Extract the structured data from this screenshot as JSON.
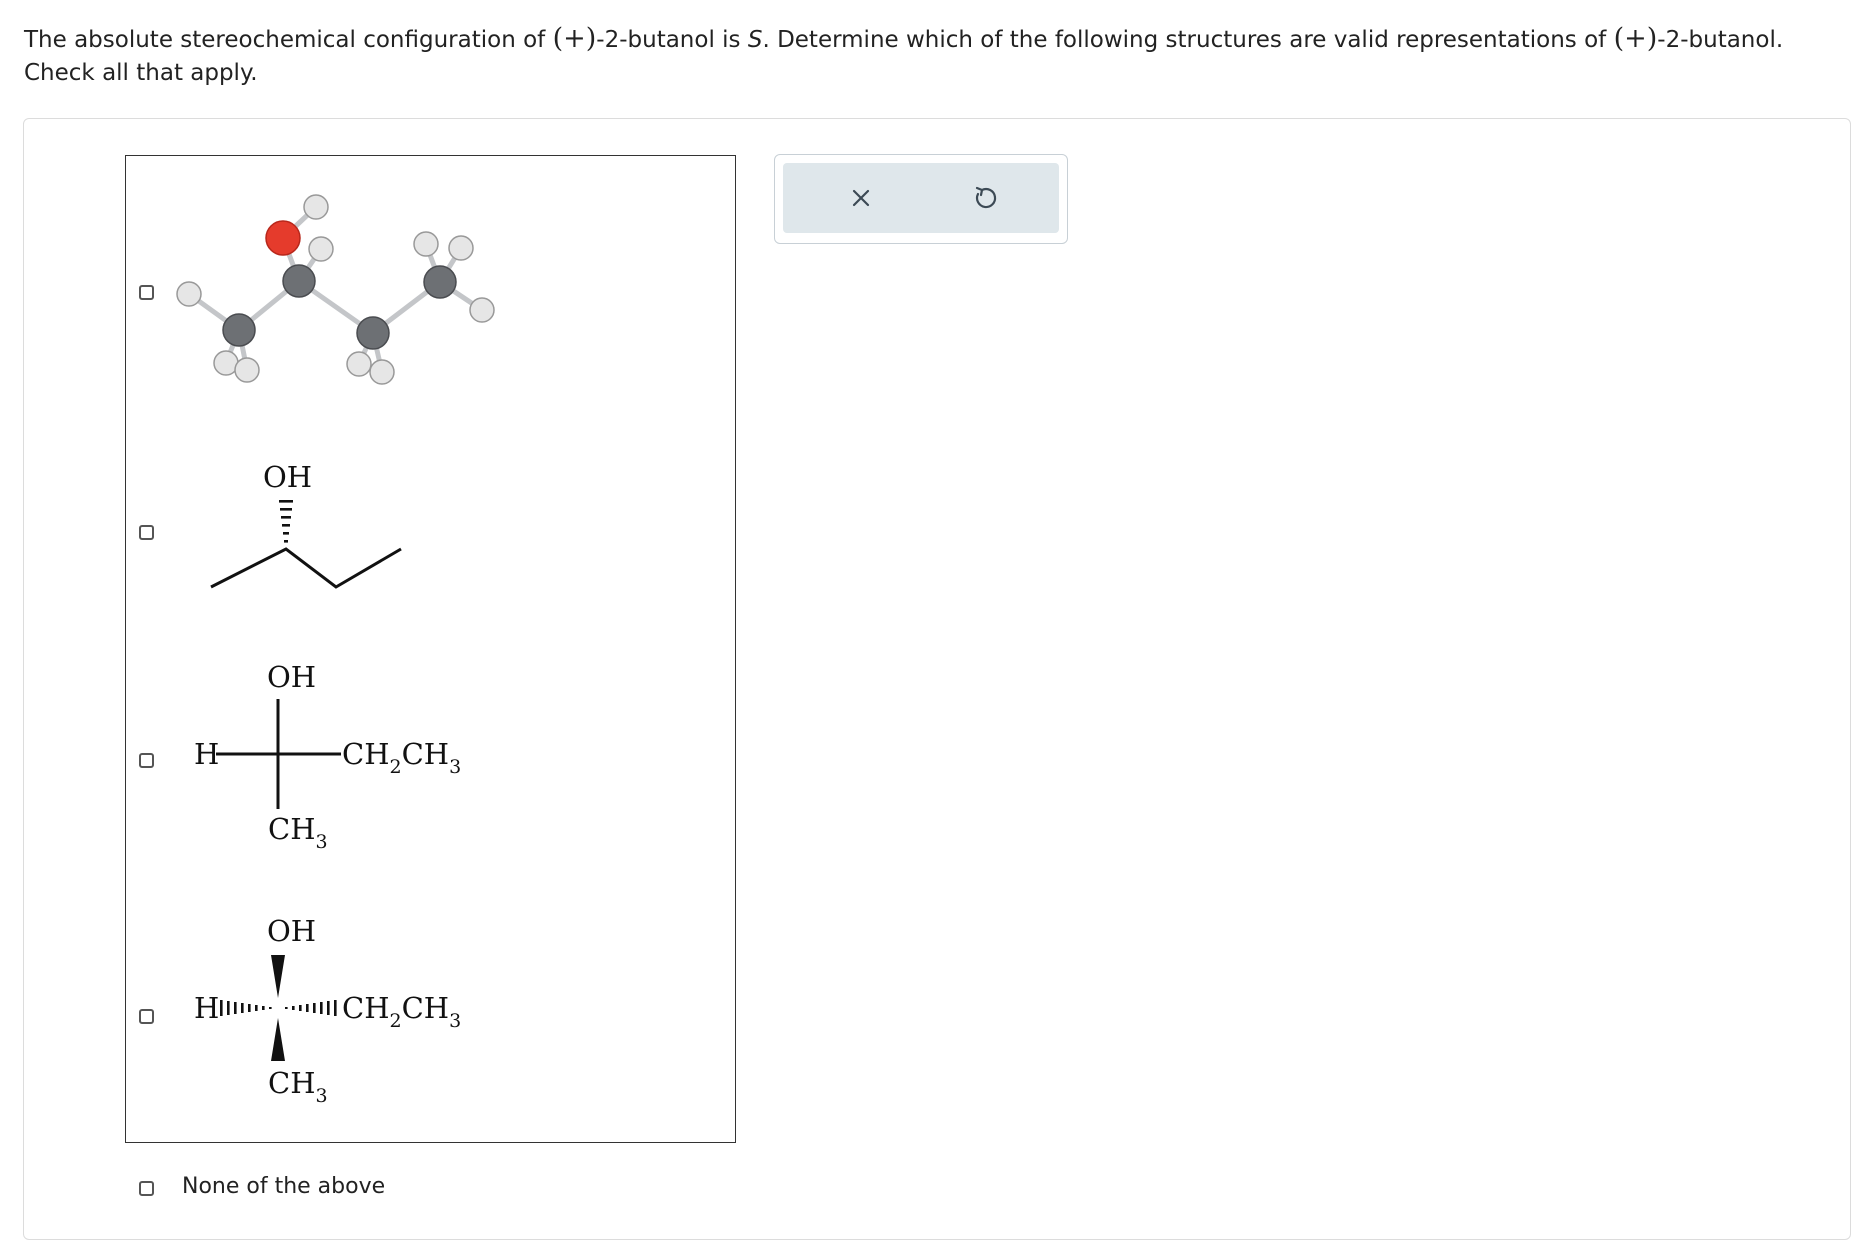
{
  "question": {
    "part1": "The absolute stereochemical configuration of ",
    "plus1": "(+)",
    "part2": "-2-butanol is ",
    "config": "S",
    "part3": ". Determine which of the following structures are valid representations of ",
    "plus2": "(+)",
    "part4": "-2-butanol. Check all that apply."
  },
  "options": [
    {
      "kind": "ball-and-stick model",
      "checked": false
    },
    {
      "kind": "skeletal formula",
      "label_oh": "OH",
      "checked": false
    },
    {
      "kind": "Fischer projection",
      "top": "OH",
      "left": "H",
      "right_main": "CH",
      "right_sub1": "2",
      "right_main2": "CH",
      "right_sub2": "3",
      "bottom_main": "CH",
      "bottom_sub": "3",
      "checked": false
    },
    {
      "kind": "wedge projection",
      "top": "OH",
      "left": "H",
      "right_main": "CH",
      "right_sub1": "2",
      "right_main2": "CH",
      "right_sub2": "3",
      "bottom_main": "CH",
      "bottom_sub": "3",
      "checked": false
    }
  ],
  "none_option": {
    "label": "None of the above",
    "checked": false
  },
  "toolbar": {
    "clear_icon": "close-icon",
    "reset_icon": "undo-icon"
  },
  "colors": {
    "oxygen": "#e53b2c",
    "carbon": "#6b6e72",
    "hydrogen": "#e4e4e4",
    "toolbar_bg": "#dfe7eb"
  }
}
